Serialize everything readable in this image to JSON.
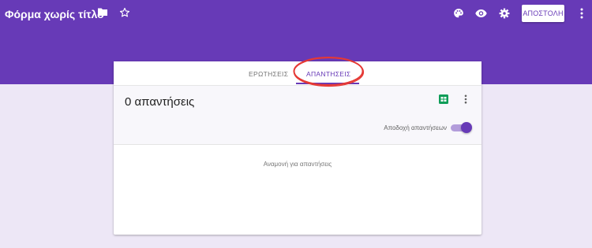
{
  "header": {
    "title": "Φόρμα χωρίς τίτλο",
    "send_label": "ΑΠΟΣΤΟΛΗ",
    "icons": [
      "folder-icon",
      "star-icon",
      "palette-icon",
      "eye-icon",
      "gear-icon",
      "more-vert-icon"
    ]
  },
  "tabs": [
    {
      "label": "ΕΡΩΤΗΣΕΙΣ",
      "active": false
    },
    {
      "label": "ΑΠΑΝΤΗΣΕΙΣ",
      "active": true
    }
  ],
  "responses": {
    "count_label": "0 απαντήσεις",
    "accepting_label": "Αποδοχή απαντήσεων",
    "accepting": true,
    "waiting_message": "Αναμονή για απαντήσεις",
    "icons": [
      "sheets-icon",
      "more-vert-icon"
    ]
  },
  "colors": {
    "accent": "#673ab7",
    "background": "#ede7f6",
    "annotation": "#e53935",
    "sheets_green": "#0f9d58"
  }
}
